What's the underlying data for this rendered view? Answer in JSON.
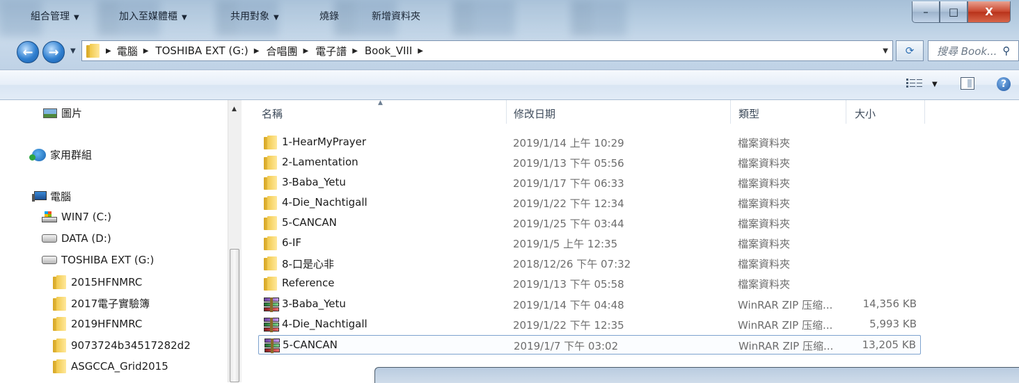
{
  "window": {
    "minimize": "–",
    "maximize": "□",
    "close": "X"
  },
  "address": {
    "crumbs": [
      "電腦",
      "TOSHIBA EXT (G:)",
      "合唱團",
      "電子譜",
      "Book_VIII"
    ],
    "search_placeholder": "搜尋 Book..."
  },
  "toolbar": {
    "organize": "組合管理",
    "add_to_library": "加入至媒體櫃",
    "share_with": "共用對象",
    "burn": "燒錄",
    "new_folder": "新增資料夾"
  },
  "nav": {
    "pictures": "圖片",
    "homegroup": "家用群組",
    "computer": "電腦",
    "drives": [
      {
        "label": "WIN7 (C:)",
        "icon": "system-drive-icon"
      },
      {
        "label": "DATA (D:)",
        "icon": "drive-icon"
      },
      {
        "label": "TOSHIBA EXT (G:)",
        "icon": "drive-icon"
      }
    ],
    "folders": [
      "2015HFNMRC",
      "2017電子實驗簿",
      "2019HFNMRC",
      "9073724b34517282d2",
      "ASGCCA_Grid2015"
    ]
  },
  "columns": {
    "name": "名稱",
    "date": "修改日期",
    "type": "類型",
    "size": "大小"
  },
  "files": [
    {
      "name": "1-HearMyPrayer",
      "date": "2019/1/14 上午 10:29",
      "type": "檔案資料夾",
      "size": "",
      "icon": "folder-icon"
    },
    {
      "name": "2-Lamentation",
      "date": "2019/1/13 下午 05:56",
      "type": "檔案資料夾",
      "size": "",
      "icon": "folder-icon"
    },
    {
      "name": "3-Baba_Yetu",
      "date": "2019/1/17 下午 06:33",
      "type": "檔案資料夾",
      "size": "",
      "icon": "folder-icon"
    },
    {
      "name": "4-Die_Nachtigall",
      "date": "2019/1/22 下午 12:34",
      "type": "檔案資料夾",
      "size": "",
      "icon": "folder-icon"
    },
    {
      "name": "5-CANCAN",
      "date": "2019/1/25 下午 03:44",
      "type": "檔案資料夾",
      "size": "",
      "icon": "folder-icon"
    },
    {
      "name": "6-IF",
      "date": "2019/1/5 上午 12:35",
      "type": "檔案資料夾",
      "size": "",
      "icon": "folder-icon"
    },
    {
      "name": "8-口是心非",
      "date": "2018/12/26 下午 07:32",
      "type": "檔案資料夾",
      "size": "",
      "icon": "folder-icon"
    },
    {
      "name": "Reference",
      "date": "2019/1/13 下午 05:58",
      "type": "檔案資料夾",
      "size": "",
      "icon": "folder-icon"
    },
    {
      "name": "3-Baba_Yetu",
      "date": "2019/1/14 下午 04:48",
      "type": "WinRAR ZIP 压缩...",
      "size": "14,356 KB",
      "icon": "winrar-icon"
    },
    {
      "name": "4-Die_Nachtigall",
      "date": "2019/1/22 下午 12:35",
      "type": "WinRAR ZIP 压缩...",
      "size": "5,993 KB",
      "icon": "winrar-icon"
    },
    {
      "name": "5-CANCAN",
      "date": "2019/1/7 下午 03:02",
      "type": "WinRAR ZIP 压缩...",
      "size": "13,205 KB",
      "icon": "winrar-icon",
      "selected": true
    }
  ]
}
